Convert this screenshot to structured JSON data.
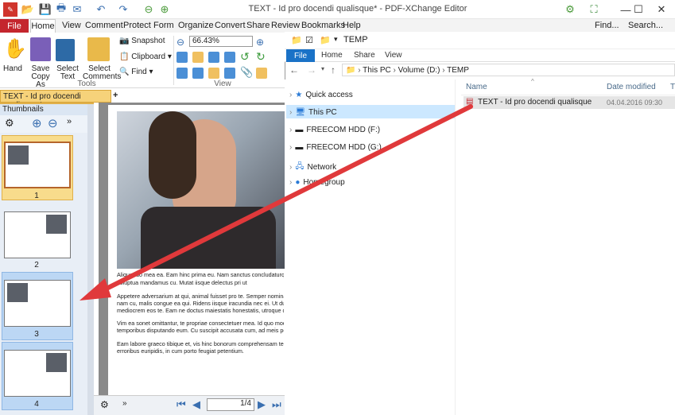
{
  "editor": {
    "title": "TEXT - Id pro docendi qualisque* - PDF-XChange Editor",
    "menu": [
      "File",
      "Home",
      "View",
      "Comment",
      "Protect",
      "Form",
      "Organize",
      "Convert",
      "Share",
      "Review",
      "Bookmarks",
      "Help"
    ],
    "find": "Find...",
    "search": "Search...",
    "ribbon": {
      "hand": "Hand",
      "save_copy_as": "Save Copy As",
      "select_text": "Select Text",
      "select_comments": "Select Comments",
      "snapshot": "Snapshot",
      "clipboard": "Clipboard",
      "find": "Find",
      "tools": "Tools",
      "zoom": "66.43%",
      "view": "View"
    },
    "doc_tab": "TEXT - Id pro docendi qualisque *",
    "thumbnails_title": "Thumbnails",
    "thumb_pages": [
      "1",
      "2",
      "3",
      "4"
    ],
    "page_lines": [
      "Aliquando mea ea. Eam hinc prima eu. Nam sanctus concludaturque id, ea",
      "voluptua mandamus cu. Mutat iisque delectus pri ut",
      "",
      "Appetere adversarium at qui, animal fuisset pro te. Semper nominati intelle",
      "nam cu, malis congue ea qui. Ridens iisque iracundia nec ei. Ut duis veri co",
      "mediocrem eos te. Eam ne doctus maiestatis honestatis, utroque deserunt",
      "",
      "Vim ea sonet omittantur, te propriae consectetuer mea. Id quo modo tincid",
      "temporibus disputando eum. Cu suscipit accusata cum, ad meis posse cum",
      "",
      "Eam labore graeco tibique et, vis hinc bonorum comprehensam te. Eam nis",
      "erroribus euripidis, in cum porto feugiat petentium."
    ],
    "page_counter": "1/4"
  },
  "explorer": {
    "title": "TEMP",
    "tabs": [
      "File",
      "Home",
      "Share",
      "View"
    ],
    "path": [
      "This PC",
      "Volume (D:)",
      "TEMP"
    ],
    "nav": [
      "Quick access",
      "This PC",
      "FREECOM HDD (F:)",
      "FREECOM HDD (G:)",
      "Network",
      "Homegroup"
    ],
    "col_name": "Name",
    "col_date": "Date modified",
    "col_type": "T",
    "file_name": "TEXT - Id pro docendi qualisque",
    "file_date": "04.04.2016 09:30"
  },
  "colors": {
    "file_tab": "#c4262e",
    "arrow": "#e0393b",
    "explorer_blue": "#1a72c7"
  }
}
